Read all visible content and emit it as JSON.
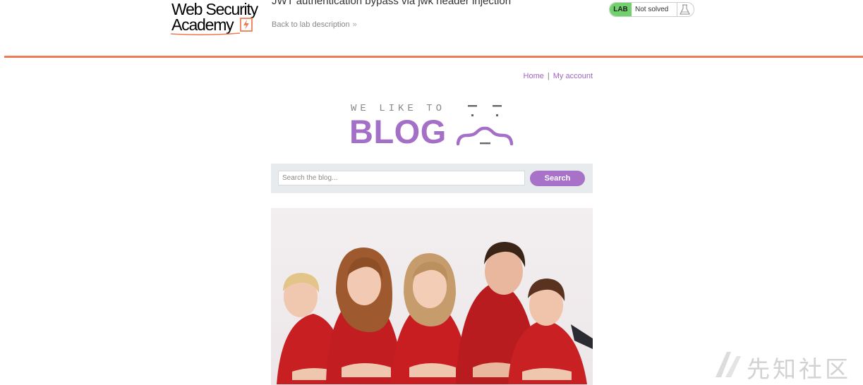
{
  "academy": {
    "logo_line1": "Web Security",
    "logo_line2": "Academy",
    "lab_title": "JWT authentication bypass via jwk header injection",
    "back_link": "Back to lab description",
    "back_chevron": "»",
    "lab_badge": "LAB",
    "lab_status": "Not solved",
    "accent_color": "#ee7d55"
  },
  "nav": {
    "home": "Home",
    "separator": "|",
    "my_account": "My account",
    "link_color": "#a064c2"
  },
  "blog_logo": {
    "tagline": "WE LIKE TO",
    "word": "BLOG",
    "brand_color": "#a46fc6"
  },
  "search": {
    "placeholder": "Search the blog...",
    "button": "Search"
  },
  "post": {
    "image_icon": "family-photo"
  },
  "watermark": {
    "text": "先知社区"
  }
}
